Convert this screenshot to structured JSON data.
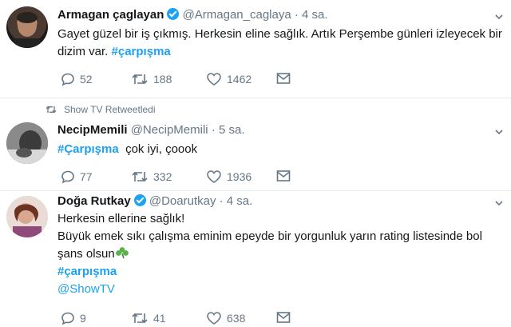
{
  "tweets": [
    {
      "name": "Armagan çaglayan",
      "handle": "@Armagan_caglaya",
      "time": "4 sa.",
      "verified": true,
      "text_line1": "Gayet güzel bir iş çıkmış. Herkesin eline sağlık. Artık Perşembe günleri izleyecek bir",
      "text_line2": "dizim var.",
      "hashtag": "#çarpışma",
      "replies": "52",
      "retweets": "188",
      "likes": "1462",
      "avatar_icon": "user-avatar-icon"
    },
    {
      "retweeted_by": "Show TV Retweetledi",
      "name": "NecipMemili",
      "handle": "@NecipMemili",
      "time": "5 sa.",
      "verified": false,
      "hashtag": "#Çarpışma",
      "text": "çok iyi, çoook",
      "replies": "77",
      "retweets": "332",
      "likes": "1936",
      "avatar_icon": "user-avatar-icon"
    },
    {
      "name": "Doğa Rutkay",
      "handle": "@Doarutkay",
      "time": "4 sa.",
      "verified": true,
      "line1": "Herkesin ellerine sağlık!",
      "line2": "Büyük emek sıkı çalışma eminim epeyde bir yorgunluk yarın rating listesinde bol",
      "line3": "şans olsun",
      "emoji": "shamrock-icon",
      "hashtag": "#çarpışma",
      "mention": "@ShowTV",
      "replies": "9",
      "retweets": "41",
      "likes": "638",
      "avatar_icon": "user-avatar-icon"
    }
  ],
  "colors": {
    "link": "#1da1f2",
    "muted": "#657786",
    "text": "#14171a",
    "separator": "#e6ecf0"
  }
}
